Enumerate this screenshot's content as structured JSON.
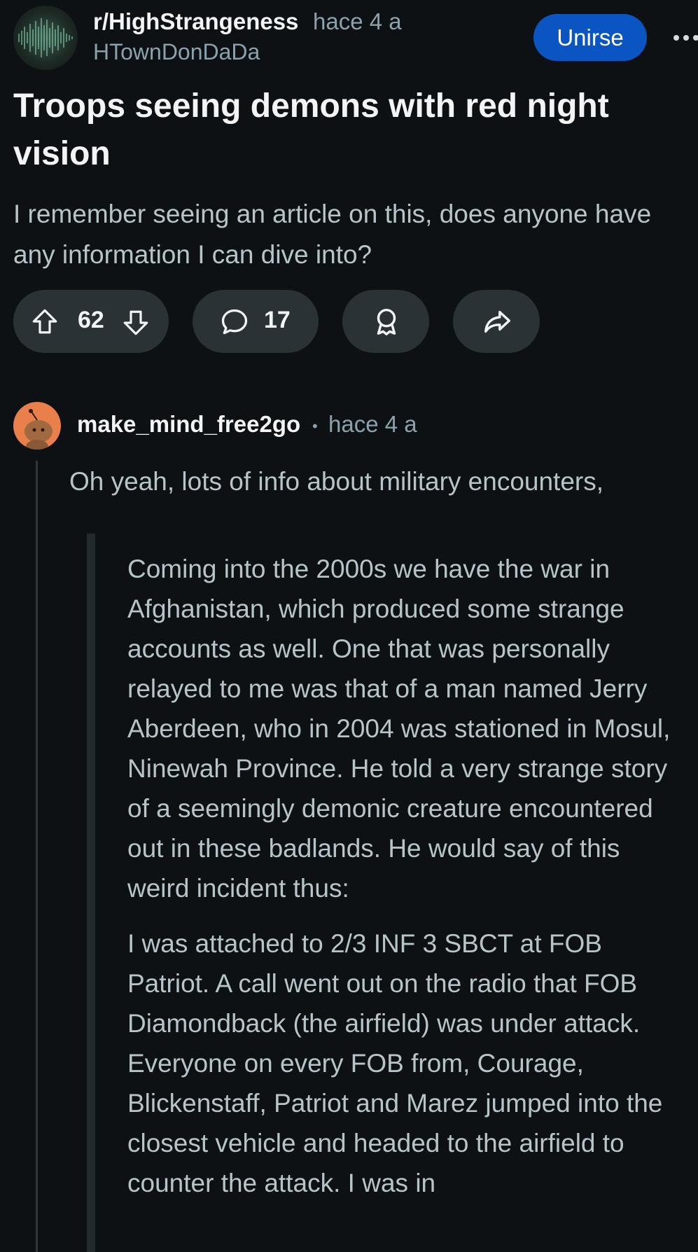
{
  "header": {
    "subreddit": "r/HighStrangeness",
    "time": "hace 4 a",
    "author": "HTownDonDaDa",
    "join_label": "Unirse"
  },
  "post": {
    "title": "Troops seeing demons with red night vision",
    "body": "I remember seeing an article on this, does anyone have any information I can dive into?"
  },
  "actions": {
    "votes": "62",
    "comments": "17",
    "icons": [
      "upvote-icon",
      "downvote-icon",
      "comment-icon",
      "award-icon",
      "share-icon"
    ]
  },
  "comment": {
    "user": "make_mind_free2go",
    "separator": "•",
    "time": "hace 4 a",
    "text": "Oh yeah, lots of info about military encounters,",
    "quote_paragraphs": [
      "Coming into the 2000s we have the war in Afghanistan, which produced some strange accounts as well. One that was personally relayed to me was that of a man named Jerry Aberdeen, who in 2004 was stationed in Mosul, Ninewah Province. He told a very strange story of a seemingly demonic creature encountered out in these badlands. He would say of this weird incident thus:",
      "I was attached to 2/3 INF 3 SBCT at FOB Patriot. A call went out on the radio that FOB Diamondback (the airfield) was under attack. Everyone on every FOB from, Courage, Blickenstaff, Patriot and Marez jumped into the closest vehicle and headed to the airfield to counter the attack. I was in"
    ]
  },
  "colors": {
    "background": "#0e1113",
    "join_button": "#0a55c2",
    "pill": "#2a3236",
    "muted_text": "#8ba2ad",
    "body_text": "#b7c4ca",
    "comment_avatar": "#e97f4b"
  }
}
